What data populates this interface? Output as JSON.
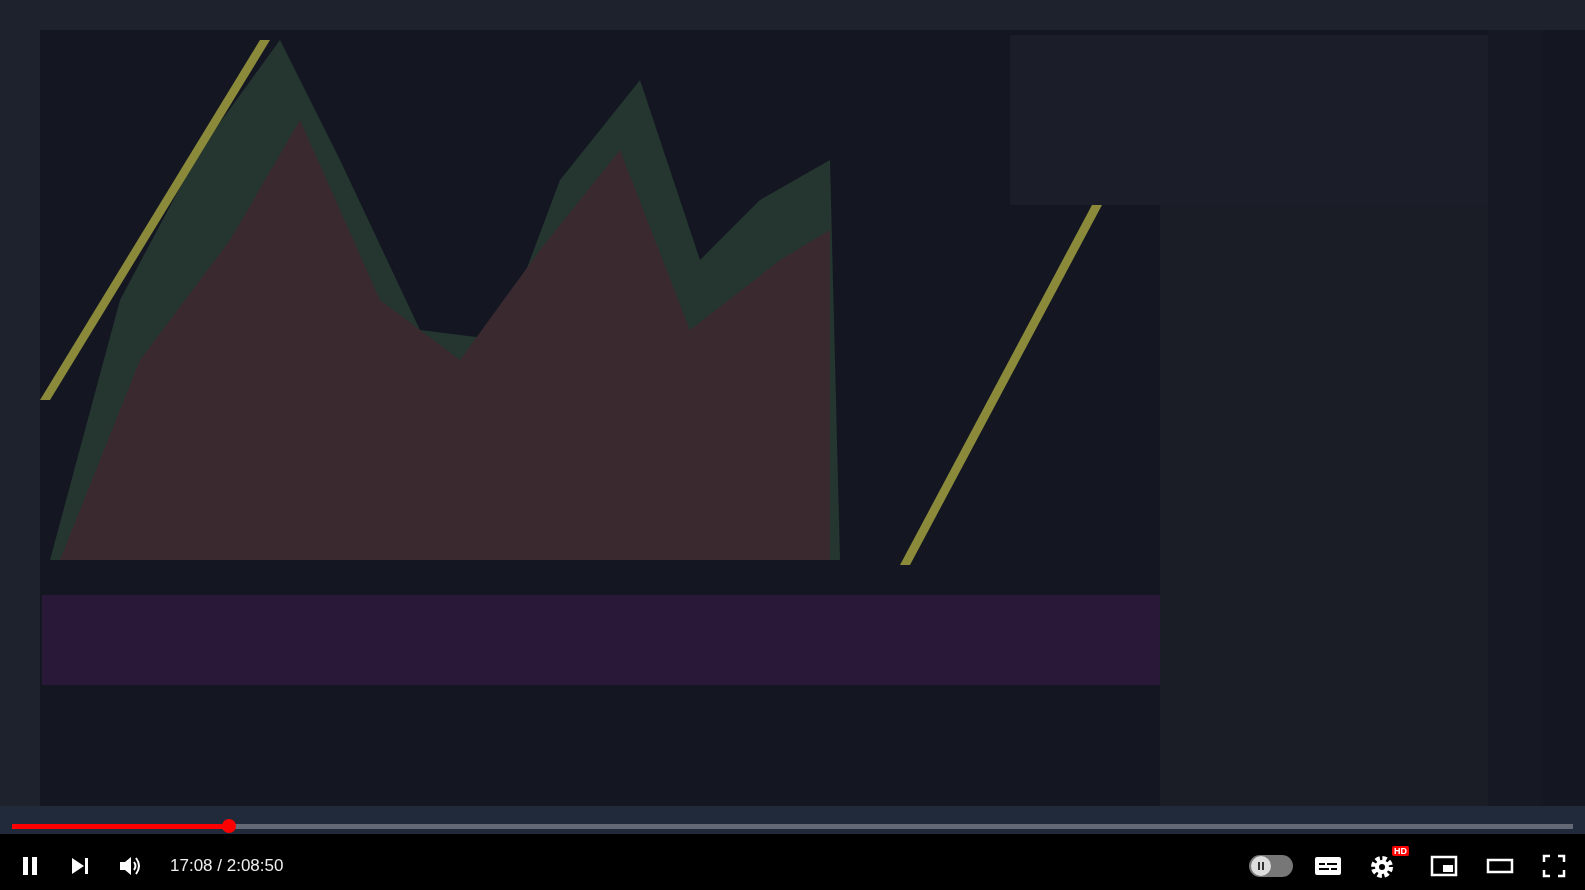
{
  "player": {
    "playing": true,
    "progress": {
      "level": 0.139
    },
    "time": "17:08 / 2:08:50",
    "autoplay": {
      "on": false
    },
    "settings_badge": "HD"
  }
}
